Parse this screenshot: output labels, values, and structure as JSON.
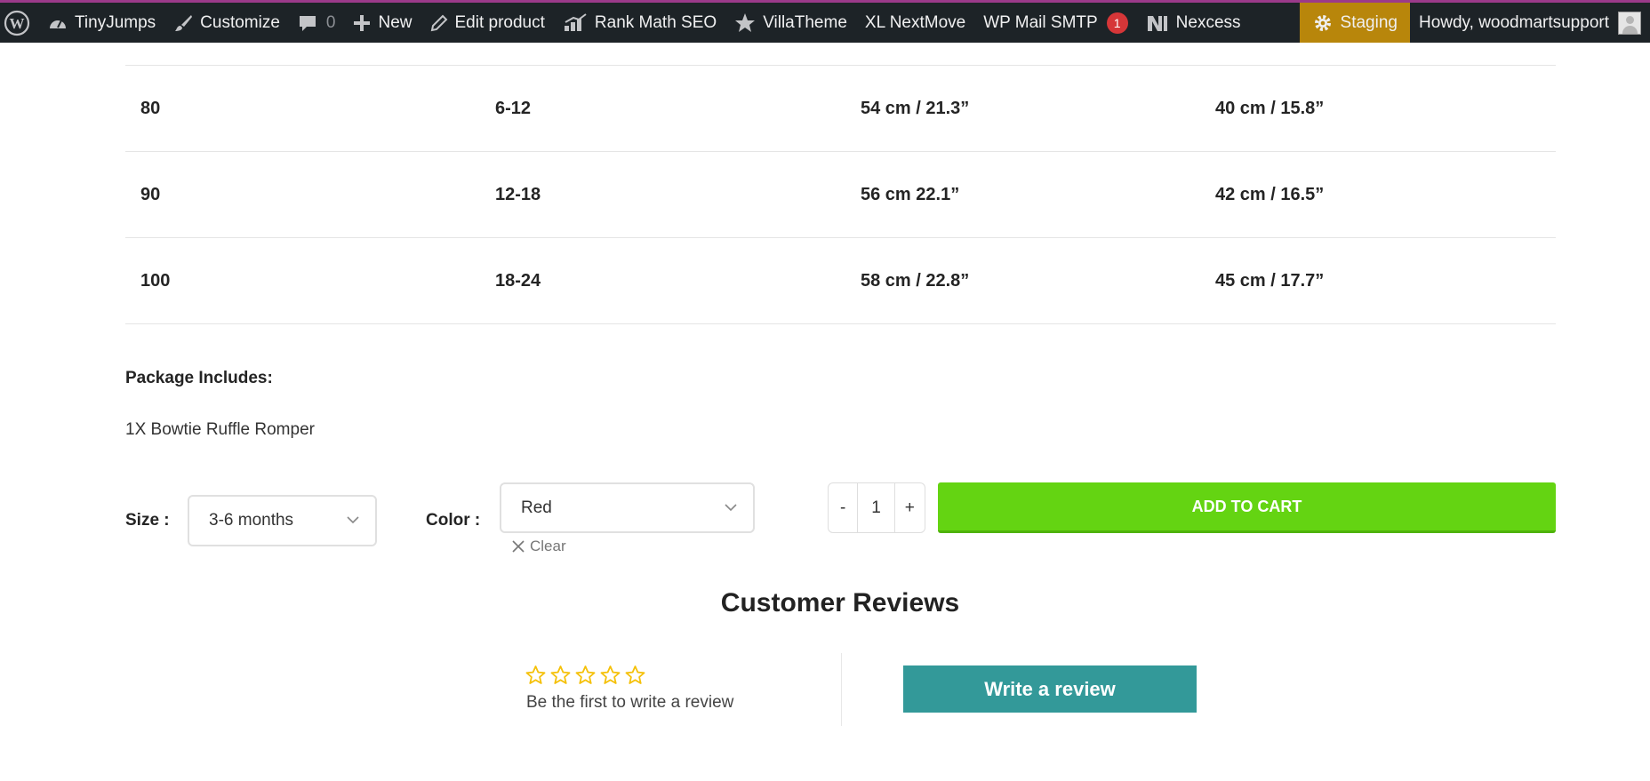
{
  "admin_bar": {
    "site_name": "TinyJumps",
    "customize": "Customize",
    "comments_count": "0",
    "new": "New",
    "edit_product": "Edit product",
    "rank_math": "Rank Math SEO",
    "villatheme": "VillaTheme",
    "xl_nextmove": "XL NextMove",
    "wp_mail_smtp": "WP Mail SMTP",
    "wp_mail_badge": "1",
    "nexcess": "Nexcess",
    "staging": "Staging",
    "howdy": "Howdy, woodmartsupport",
    "staging_color": "#b8860b",
    "bar_color": "#1d2327"
  },
  "size_table": {
    "rows": [
      [
        "80",
        "6-12",
        "54 cm  / 21.3”",
        "40 cm / 15.8”"
      ],
      [
        "90",
        "12-18",
        "56 cm 22.1”",
        "42 cm / 16.5”"
      ],
      [
        "100",
        "18-24",
        "58 cm / 22.8”",
        "45 cm / 17.7”"
      ]
    ]
  },
  "package": {
    "title": "Package Includes:",
    "item": "1X Bowtie Ruffle Romper"
  },
  "variations": {
    "size_label": "Size :",
    "size_value": "3-6 months",
    "color_label": "Color :",
    "color_value": "Red",
    "clear_label": "Clear"
  },
  "cart": {
    "minus": "-",
    "quantity": "1",
    "plus": "+",
    "add_to_cart": "ADD TO CART",
    "button_color": "#64d412"
  },
  "reviews": {
    "title": "Customer Reviews",
    "first_review": "Be the first to write a review",
    "write_button": "Write a review",
    "star_color": "#f5c10a",
    "button_color": "#339999",
    "rating": 0,
    "rating_max": 5
  }
}
